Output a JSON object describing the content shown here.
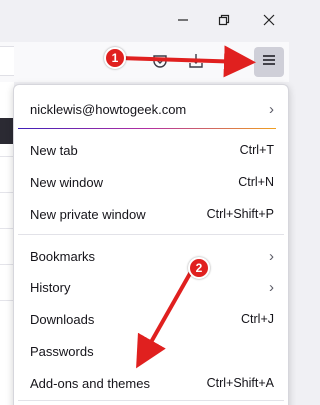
{
  "account": {
    "email": "nicklewis@howtogeek.com"
  },
  "menu": {
    "new_tab": {
      "label": "New tab",
      "shortcut": "Ctrl+T"
    },
    "new_window": {
      "label": "New window",
      "shortcut": "Ctrl+N"
    },
    "new_private_window": {
      "label": "New private window",
      "shortcut": "Ctrl+Shift+P"
    },
    "bookmarks": {
      "label": "Bookmarks"
    },
    "history": {
      "label": "History"
    },
    "downloads": {
      "label": "Downloads",
      "shortcut": "Ctrl+J"
    },
    "passwords": {
      "label": "Passwords"
    },
    "addons": {
      "label": "Add-ons and themes",
      "shortcut": "Ctrl+Shift+A"
    }
  },
  "annotations": {
    "step1": "1",
    "step2": "2"
  },
  "colors": {
    "annotation_red": "#e0201f",
    "menu_button_bg": "#cfcfd8"
  },
  "icons": [
    "minimize-icon",
    "restore-icon",
    "close-icon",
    "pocket-icon",
    "downloads-icon",
    "extension-icon",
    "hamburger-menu-icon",
    "chevron-right-icon"
  ]
}
